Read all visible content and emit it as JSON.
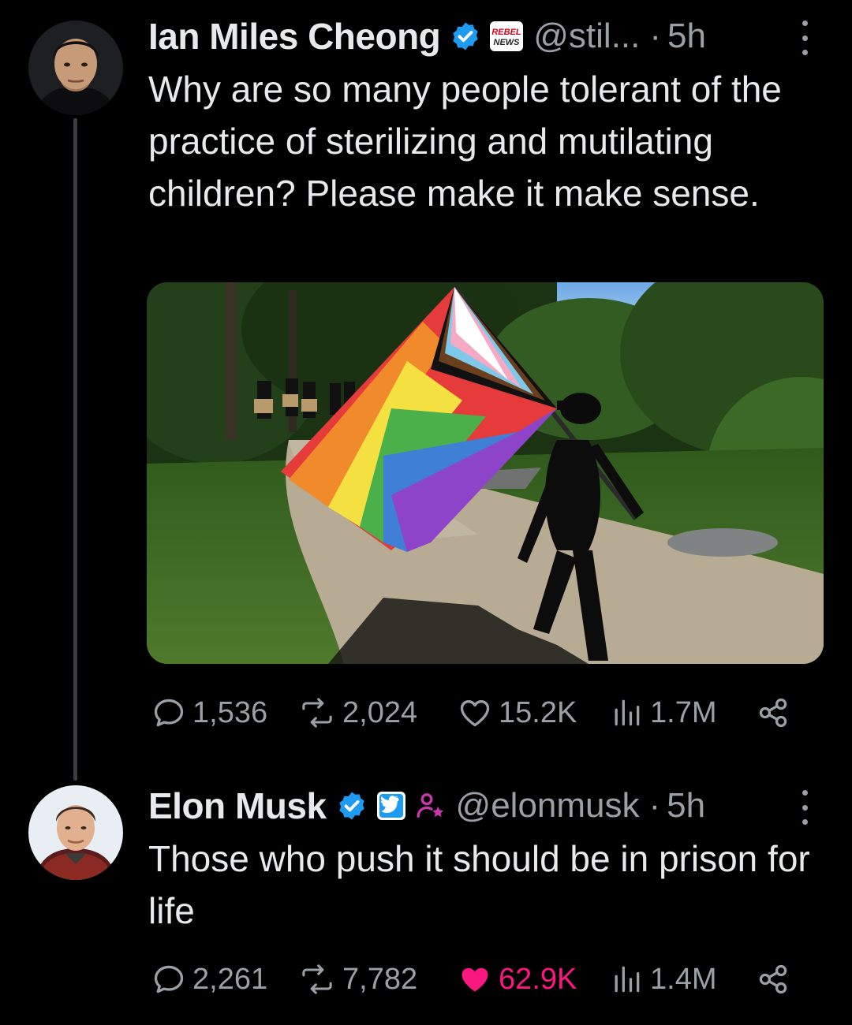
{
  "tweets": [
    {
      "author": {
        "name": "Ian Miles Cheong",
        "handle": "@stil...",
        "verified": true,
        "affiliate_badge": "rebel-news-badge",
        "affiliate_text": "REBEL NEWS"
      },
      "time_sep": "·",
      "time": "5h",
      "text": "Why are so many people tolerant of the practice of sterilizing and mutilating children? Please make it make sense.",
      "has_image": true,
      "stats": {
        "replies": "1,536",
        "reposts": "2,024",
        "likes": "15.2K",
        "views": "1.7M"
      }
    },
    {
      "author": {
        "name": "Elon Musk",
        "handle": "@elonmusk",
        "verified": true,
        "affiliate_badge": "twitter-badge",
        "extra_badge": "person-star-icon"
      },
      "time_sep": "·",
      "time": "5h",
      "text": "Those who push it should be in prison for life",
      "has_image": false,
      "liked": true,
      "stats": {
        "replies": "2,261",
        "reposts": "7,782",
        "likes": "62.9K",
        "views": "1.4M"
      }
    }
  ],
  "colors": {
    "background": "#000000",
    "text": "#e7e9ea",
    "muted": "#9aa0a6",
    "verified_blue": "#1d9bf0",
    "like_pink": "#f91880",
    "thread_line": "#3a3d42",
    "extra_badge": "#c837ab"
  }
}
